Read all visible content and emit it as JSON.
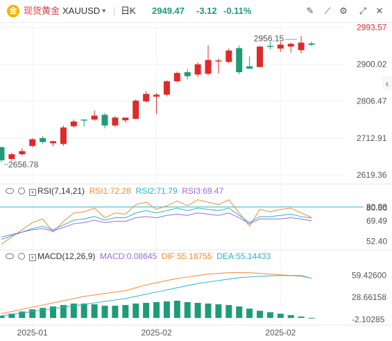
{
  "header": {
    "logo_glyph": "金",
    "name": "现货黄金",
    "symbol": "XAUUSD",
    "dropdown_glyph": "▾",
    "interval": "日K",
    "price": "2949.47",
    "change": "-3.12",
    "change_pct": "-0.11%",
    "colors": {
      "up": "#e02a2a",
      "down": "#1e9c76",
      "brand": "#e23b3b",
      "accent": "#1e9c76"
    },
    "tools": [
      {
        "icon": "draw-line-icon",
        "glyph": "✎"
      },
      {
        "icon": "trend-tool-icon",
        "glyph": "⟋"
      },
      {
        "icon": "indicator-settings-icon",
        "glyph": "⚙"
      },
      {
        "icon": "fullscreen-icon",
        "glyph": "⤢"
      },
      {
        "icon": "close-icon",
        "glyph": "✕"
      }
    ],
    "side_tab_glyph": "‹"
  },
  "chart_data": [
    {
      "type": "candlestick",
      "title": "现货黄金 XAUUSD 日K",
      "price_axis_ticks": [
        2993.57,
        2900.02,
        2806.47,
        2712.91,
        2619.36
      ],
      "price_axis_labels": [
        "2993.57",
        "2900.02",
        "2806.47",
        "2712.91",
        "2619.36"
      ],
      "ylim": [
        2600,
        3005
      ],
      "annotations": [
        {
          "label": "2956.15",
          "value": 2956.15
        },
        {
          "label": "2656.78",
          "value": 2656.78
        }
      ],
      "x_tick_labels": [
        {
          "index": 3,
          "label": "2025-01"
        },
        {
          "index": 15,
          "label": "2025-02"
        },
        {
          "index": 27,
          "label": "2025-02"
        }
      ],
      "ohlc": [
        [
          2690,
          2692,
          2652,
          2656.78
        ],
        [
          2660,
          2676,
          2655,
          2672
        ],
        [
          2672,
          2687,
          2668,
          2680
        ],
        [
          2693,
          2713,
          2690,
          2710
        ],
        [
          2713,
          2718,
          2699,
          2703
        ],
        [
          2700,
          2706,
          2692,
          2705
        ],
        [
          2698,
          2745,
          2693,
          2740
        ],
        [
          2743,
          2760,
          2739,
          2755
        ],
        [
          2760,
          2760,
          2742,
          2758
        ],
        [
          2760,
          2783,
          2757,
          2770
        ],
        [
          2772,
          2777,
          2738,
          2745
        ],
        [
          2745,
          2769,
          2741,
          2765
        ],
        [
          2758,
          2764,
          2752,
          2765
        ],
        [
          2762,
          2811,
          2760,
          2808
        ],
        [
          2806,
          2832,
          2803,
          2825
        ],
        [
          2818,
          2827,
          2774,
          2823
        ],
        [
          2823,
          2860,
          2819,
          2857
        ],
        [
          2857,
          2882,
          2855,
          2878
        ],
        [
          2880,
          2888,
          2862,
          2870
        ],
        [
          2874,
          2905,
          2868,
          2900
        ],
        [
          2876,
          2948,
          2872,
          2911
        ],
        [
          2910,
          2915,
          2877,
          2910
        ],
        [
          2906,
          2940,
          2903,
          2935
        ],
        [
          2941,
          2948,
          2875,
          2880
        ],
        [
          2895,
          2920,
          2890,
          2889
        ],
        [
          2893,
          2947,
          2895,
          2945
        ],
        [
          2947,
          2957,
          2938,
          2945
        ],
        [
          2940,
          2957,
          2932,
          2950
        ],
        [
          2945,
          2955,
          2930,
          2952
        ],
        [
          2936,
          2972,
          2928,
          2955
        ],
        [
          2953,
          2958,
          2946,
          2949.47
        ]
      ],
      "colors": {
        "up": "#e02a2a",
        "down": "#1e9c76"
      }
    },
    {
      "type": "line",
      "title": "RSI(7,14,21)",
      "ylim": [
        48,
        92
      ],
      "ticks": [
        {
          "label": "80.00",
          "value": 80.0
        },
        {
          "label": "80.98",
          "value": 80.98
        },
        {
          "label": "69.49",
          "value": 69.49
        },
        {
          "label": "52.40",
          "value": 52.4
        }
      ],
      "ref_line": 80.98,
      "series": [
        {
          "name": "RSI1",
          "value_label": "72.28",
          "color": "#ef8b35",
          "values": [
            50,
            56,
            62,
            68,
            71,
            60,
            69,
            76,
            77,
            80,
            72,
            76,
            75,
            83,
            85,
            79,
            82,
            86,
            82,
            87,
            85,
            83,
            87,
            76,
            65,
            79,
            77,
            79,
            80,
            76,
            72.28
          ]
        },
        {
          "name": "RSI2",
          "value_label": "71.79",
          "color": "#29b4c7",
          "values": [
            54,
            57,
            60,
            63,
            65,
            62,
            66,
            70,
            71,
            73,
            70,
            72,
            72,
            76,
            78,
            76,
            78,
            80,
            78,
            80,
            79,
            78,
            80,
            74,
            68,
            73,
            73,
            74,
            75,
            73,
            71.79
          ]
        },
        {
          "name": "RSI3",
          "value_label": "69.47",
          "color": "#9a6dd1",
          "values": [
            56,
            58,
            60,
            62,
            63,
            61,
            64,
            67,
            68,
            70,
            68,
            69,
            69,
            72,
            73,
            72,
            74,
            75,
            74,
            76,
            75,
            74,
            76,
            72,
            67,
            71,
            71,
            71,
            72,
            71,
            69.47
          ]
        }
      ]
    },
    {
      "type": "bar",
      "title": "MACD(12,26,9)",
      "ylim": [
        -5,
        80
      ],
      "ticks": [
        {
          "label": "59.42600",
          "value": 59.426
        },
        {
          "label": "28.66158",
          "value": 28.66158
        },
        {
          "label": "-2.10285",
          "value": -2.10285
        }
      ],
      "series": [
        {
          "name": "MACD",
          "value_label": "0.08645",
          "color": "#9a6dd1",
          "values": [
            3,
            6,
            9,
            12,
            14,
            16,
            18,
            20,
            20,
            19,
            17,
            17,
            18,
            20,
            21,
            22,
            23,
            24,
            22,
            21,
            20,
            19,
            18,
            16,
            13,
            10,
            8,
            6,
            4,
            2,
            0.08645
          ]
        },
        {
          "name": "DIF",
          "value_label": "55.18755",
          "color": "#ef8b35",
          "values": [
            6,
            9,
            12,
            15,
            18,
            21,
            24,
            27,
            30,
            32,
            34,
            36,
            38,
            42,
            46,
            49,
            52,
            55,
            57,
            59,
            61,
            62,
            63,
            63,
            63,
            62,
            61,
            60,
            59,
            58,
            55.18755
          ]
        },
        {
          "name": "DEA",
          "value_label": "55.14433",
          "color": "#29b4c7",
          "values": [
            3,
            5,
            7,
            9,
            11,
            13,
            15,
            17,
            19,
            21,
            23,
            25,
            27,
            30,
            33,
            36,
            39,
            42,
            45,
            48,
            50,
            52,
            54,
            56,
            57,
            58,
            58.5,
            59,
            59,
            59,
            55.14433
          ]
        }
      ]
    }
  ]
}
